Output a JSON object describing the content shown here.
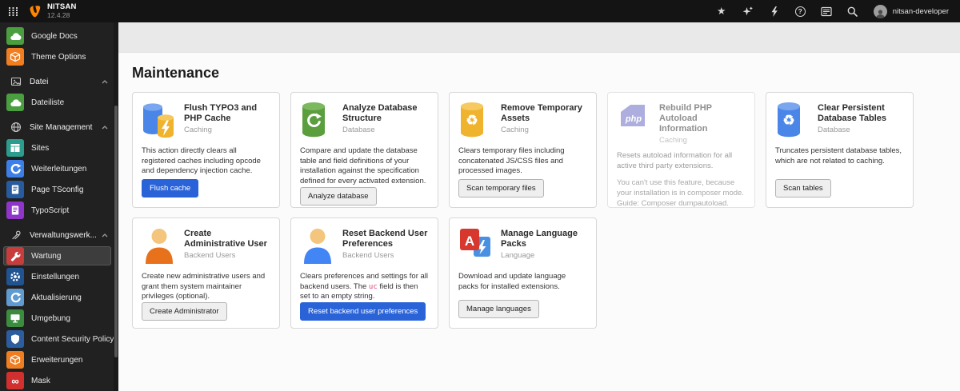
{
  "topbar": {
    "brand": "NITSAN",
    "version": "12.4.28",
    "user": "nitsan-developer",
    "icons": [
      "apps-grid",
      "typo3-logo",
      "bookmarks-star",
      "sparkle-new",
      "system-bolt",
      "help",
      "log",
      "search",
      "avatar"
    ]
  },
  "sidebar": {
    "items": [
      {
        "label": "Google Docs",
        "type": "module",
        "icon": "cloud",
        "color": "#4a9e3f"
      },
      {
        "label": "Theme Options",
        "type": "module",
        "icon": "cube",
        "color": "#f07d20"
      },
      {
        "label": "Datei",
        "type": "section",
        "icon": "picture"
      },
      {
        "label": "Dateiliste",
        "type": "module",
        "icon": "cloud",
        "color": "#4a9e3f"
      },
      {
        "label": "Site Management",
        "type": "section",
        "icon": "globe"
      },
      {
        "label": "Sites",
        "type": "module",
        "icon": "window",
        "color": "#2b9c8e"
      },
      {
        "label": "Weiterleitungen",
        "type": "module",
        "icon": "redirect-arrow",
        "color": "#3d7fe8"
      },
      {
        "label": "Page TSconfig",
        "type": "module",
        "icon": "document",
        "color": "#275a9e"
      },
      {
        "label": "TypoScript",
        "type": "module",
        "icon": "document",
        "color": "#8f35c9"
      },
      {
        "label": "Verwaltungswerk...",
        "type": "section",
        "icon": "tools"
      },
      {
        "label": "Wartung",
        "type": "module",
        "icon": "wrench",
        "color": "#c83c3c",
        "active": true
      },
      {
        "label": "Einstellungen",
        "type": "module",
        "icon": "gear",
        "color": "#20538f"
      },
      {
        "label": "Aktualisierung",
        "type": "module",
        "icon": "refresh",
        "color": "#5f9ad1"
      },
      {
        "label": "Umgebung",
        "type": "module",
        "icon": "monitor",
        "color": "#3c8c40"
      },
      {
        "label": "Content Security Policy",
        "type": "module",
        "icon": "shield",
        "color": "#2c5d9e"
      },
      {
        "label": "Erweiterungen",
        "type": "module",
        "icon": "cube",
        "color": "#f07d20"
      },
      {
        "label": "Mask",
        "type": "module",
        "icon": "mask",
        "color": "#d22f2f"
      }
    ]
  },
  "main": {
    "title": "Maintenance",
    "cards": [
      {
        "title": "Flush TYPO3 and PHP Cache",
        "tag": "Caching",
        "desc": "This action directly clears all registered caches including opcode and dependency injection cache.",
        "button": "Flush cache",
        "button_style": "primary",
        "icon": "database-bolt"
      },
      {
        "title": "Analyze Database Structure",
        "tag": "Database",
        "desc": "Compare and update the database table and field definitions of your installation against the specification defined for every activated extension.",
        "button": "Analyze database",
        "button_style": "default",
        "icon": "database-refresh"
      },
      {
        "title": "Remove Temporary Assets",
        "tag": "Caching",
        "desc": "Clears temporary files including concatenated JS/CSS files and processed images.",
        "button": "Scan temporary files",
        "button_style": "default",
        "icon": "database-recycle-yellow"
      },
      {
        "title": "Rebuild PHP Autoload Information",
        "tag": "Caching",
        "desc": "Resets autoload information for all active third party extensions.",
        "note": "You can't use this feature, because your installation is in composer mode. Guide: Composer dumpautoload.",
        "disabled": true,
        "icon": "php"
      },
      {
        "title": "Clear Persistent Database Tables",
        "tag": "Database",
        "desc": "Truncates persistent database tables, which are not related to caching.",
        "button": "Scan tables",
        "button_style": "default",
        "icon": "database-recycle-blue"
      },
      {
        "title": "Create Administrative User",
        "tag": "Backend Users",
        "desc": "Create new administrative users and grant them system maintainer privileges (optional).",
        "button": "Create Administrator",
        "button_style": "default",
        "icon": "user-orange"
      },
      {
        "title": "Reset Backend User Preferences",
        "tag": "Backend Users",
        "desc_pre": "Clears preferences and settings for all backend users. The ",
        "code": "uc",
        "desc_post": " field is then set to an empty string.",
        "button": "Reset backend user preferences",
        "button_style": "primary",
        "icon": "user-blue"
      },
      {
        "title": "Manage Language Packs",
        "tag": "Language",
        "desc": "Download and update language packs for installed extensions.",
        "button": "Manage languages",
        "button_style": "default",
        "icon": "language"
      }
    ]
  },
  "colors": {
    "typo3_orange": "#ff8700",
    "primary_button": "#2a63d8",
    "code_pink": "#e0447c",
    "topbar_bg": "#141414",
    "sidebar_bg": "#212121"
  }
}
